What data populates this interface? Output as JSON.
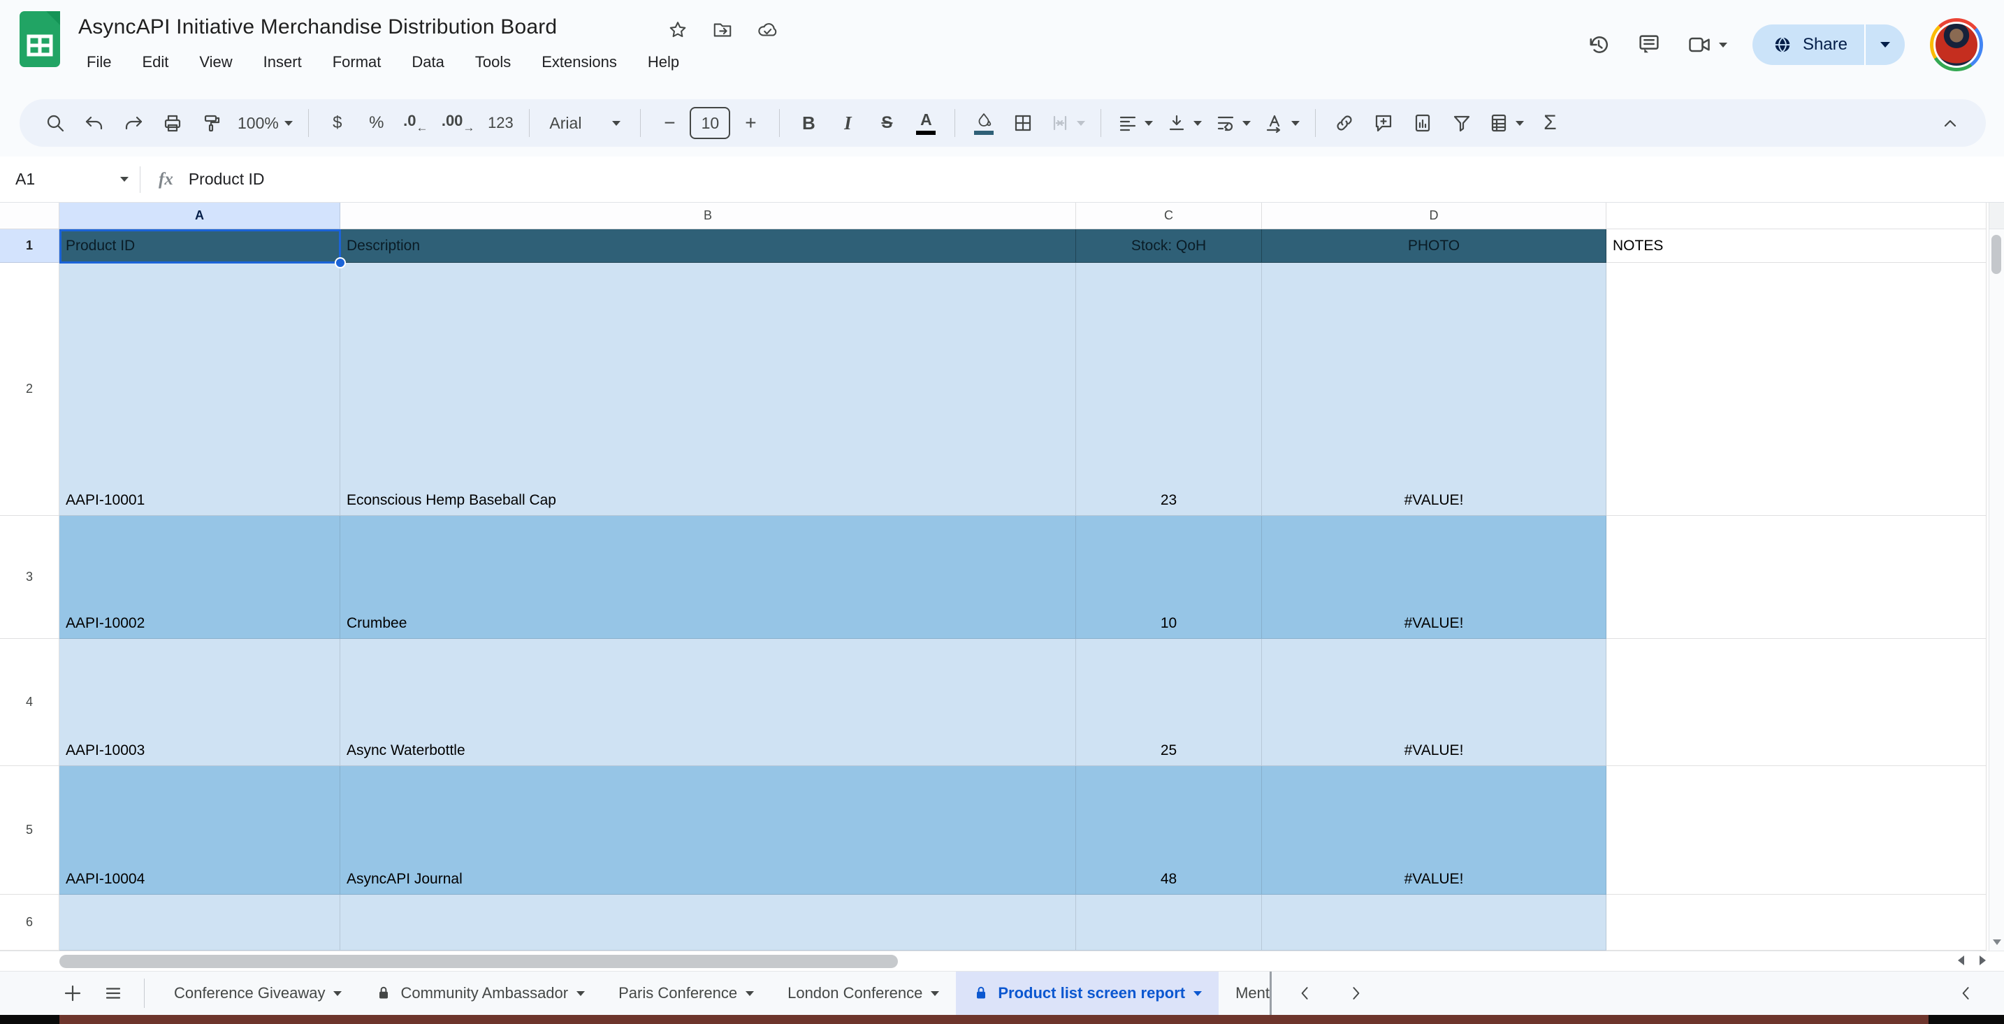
{
  "header": {
    "title": "AsyncAPI Initiative Merchandise Distribution Board",
    "menu_items": [
      "File",
      "Edit",
      "View",
      "Insert",
      "Format",
      "Data",
      "Tools",
      "Extensions",
      "Help"
    ],
    "share_label": "Share"
  },
  "toolbar": {
    "zoom_value": "100%",
    "font_name": "Arial",
    "font_size": "10",
    "labels": {
      "currency": "$",
      "percent": "%",
      "decrease_decimal": ".0",
      "increase_decimal": ".00",
      "more_formats": "123",
      "bold": "B",
      "italic": "I",
      "strikethrough": "S",
      "text_color": "A",
      "functions": "Σ"
    }
  },
  "formula_bar": {
    "cell_ref": "A1",
    "fx": "fx",
    "content": "Product ID"
  },
  "grid": {
    "column_letters": [
      "A",
      "B",
      "C",
      "D",
      ""
    ],
    "rows": [
      {
        "num": "1",
        "a": "Product ID",
        "b": "Description",
        "c": "Stock: QoH",
        "d": "PHOTO",
        "e": "NOTES"
      },
      {
        "num": "2",
        "a": "AAPI-10001",
        "b": "Econscious Hemp Baseball Cap",
        "c": "23",
        "d": "#VALUE!",
        "e": ""
      },
      {
        "num": "3",
        "a": "AAPI-10002",
        "b": "Crumbee",
        "c": "10",
        "d": "#VALUE!",
        "e": ""
      },
      {
        "num": "4",
        "a": "AAPI-10003",
        "b": "Async Waterbottle",
        "c": "25",
        "d": "#VALUE!",
        "e": ""
      },
      {
        "num": "5",
        "a": "AAPI-10004",
        "b": "AsyncAPI Journal",
        "c": "48",
        "d": "#VALUE!",
        "e": ""
      },
      {
        "num": "6",
        "a": "",
        "b": "",
        "c": "",
        "d": "",
        "e": ""
      }
    ],
    "colors": {
      "header_row_bg": "#2f6077",
      "band_light": "#cfe2f3",
      "band_medium": "#96c5e6",
      "selection": "#1b63d8",
      "selected_header_bg": "#d3e3fd"
    }
  },
  "sheet_tabs": {
    "tabs": [
      {
        "label": "Conference Giveaway",
        "locked": false,
        "active": false
      },
      {
        "label": "Community Ambassador",
        "locked": true,
        "active": false
      },
      {
        "label": "Paris Conference",
        "locked": false,
        "active": false
      },
      {
        "label": "London Conference",
        "locked": false,
        "active": false
      },
      {
        "label": "Product list screen report",
        "locked": true,
        "active": true
      },
      {
        "label": "Ment",
        "locked": false,
        "active": false
      }
    ]
  }
}
